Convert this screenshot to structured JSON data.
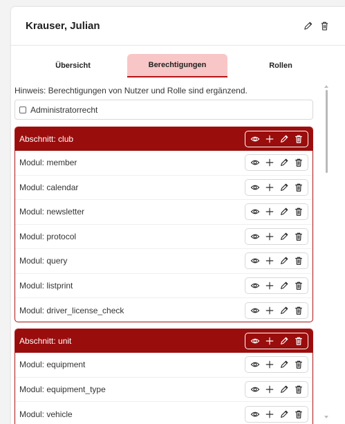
{
  "header": {
    "title": "Krauser, Julian"
  },
  "tabs": [
    {
      "label": "Übersicht"
    },
    {
      "label": "Berechtigungen"
    },
    {
      "label": "Rollen"
    }
  ],
  "hint": "Hinweis: Berechtigungen von Nutzer und Rolle sind ergänzend.",
  "admin": {
    "label": "Administratorrecht"
  },
  "sections": [
    {
      "title": "Abschnitt: club",
      "modules": [
        "Modul: member",
        "Modul: calendar",
        "Modul: newsletter",
        "Modul: protocol",
        "Modul: query",
        "Modul: listprint",
        "Modul: driver_license_check"
      ]
    },
    {
      "title": "Abschnitt: unit",
      "modules": [
        "Modul: equipment",
        "Modul: equipment_type",
        "Modul: vehicle"
      ]
    }
  ],
  "colors": {
    "accent": "#9a0d0d",
    "tab_active_bg": "#f8c6c6",
    "tab_active_border": "#b11414"
  },
  "icons": {
    "view": "eye-icon",
    "add": "plus-icon",
    "edit": "pencil-icon",
    "delete": "trash-icon"
  }
}
